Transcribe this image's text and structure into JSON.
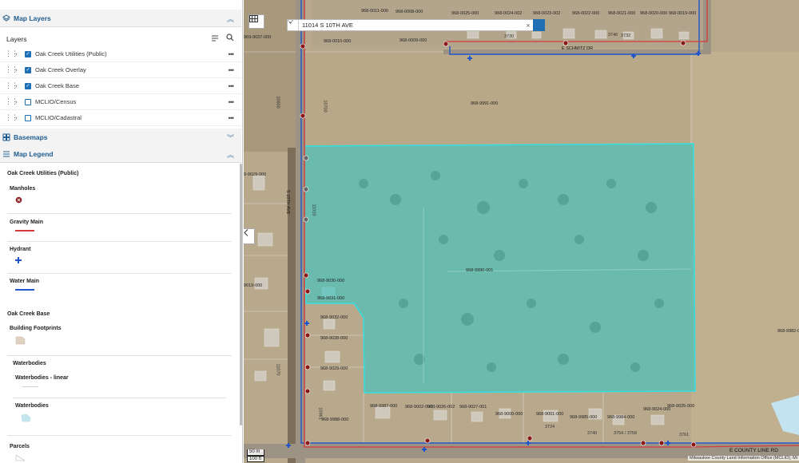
{
  "panel": {
    "map_layers_title": "Map Layers",
    "layers_label": "Layers",
    "layers": [
      {
        "label": "Oak Creek Utilities (Public)",
        "checked": true
      },
      {
        "label": "Oak Creek Overlay",
        "checked": true
      },
      {
        "label": "Oak Creek Base",
        "checked": true
      },
      {
        "label": "MCLIO/Census",
        "checked": false
      },
      {
        "label": "MCLIO/Cadastral",
        "checked": false
      }
    ],
    "basemaps_title": "Basemaps",
    "map_legend_title": "Map Legend"
  },
  "legend": {
    "utilities_title": "Oak Creek Utilities (Public)",
    "manholes": "Manholes",
    "gravity_main": "Gravity Main",
    "hydrant": "Hydrant",
    "water_main": "Water Main",
    "base_title": "Oak Creek Base",
    "building_footprints": "Building Footprints",
    "waterbodies_group": "Waterbodies",
    "waterbodies_linear": "Waterbodies - linear",
    "waterbodies": "Waterbodies",
    "parcels": "Parcels"
  },
  "map": {
    "search_value": "11014 S 10TH AVE",
    "scale_metric": "50 m",
    "scale_imperial": "100 ft",
    "attribution": "Milwaukee County Land Information Office (MCLIO), Mi",
    "roads": {
      "schmitz": "E SCHMITZ DR",
      "tenth": "S 10TH AVE",
      "county_line": "E COUNTY LINE RD"
    },
    "parcel_labels": [
      "968-0011-000",
      "968-0008-000",
      "968-0025-000",
      "968-0024-002",
      "968-0023-002",
      "968-0022-000",
      "968-0021-000",
      "968-0020-000",
      "968-0019-000",
      "968-0010-000",
      "968-0009-000",
      "969-9037-000",
      "968-9991-000",
      "968-9990-001",
      "968-9030-000",
      "968-9031-000",
      "968-9032-000",
      "968-9028-000",
      "968-9029-000",
      "968-9987-000",
      "968-9002-000",
      "968-9026-002",
      "968-9027-001",
      "968-9000-000",
      "968-9001-000",
      "968-9985-000",
      "968-9984-000",
      "968-9024-000",
      "968-9025-000",
      "968-9988-000",
      "968-9982-0",
      "9-9029-000",
      "9019-000"
    ],
    "address_labels": [
      "3730",
      "3746",
      "3732",
      "3740",
      "3754 / 3758",
      "3724",
      "3761",
      "10700",
      "10600",
      "11010",
      "11070",
      "10961"
    ]
  },
  "colors": {
    "accent": "#1f5c8f",
    "selection_fill": "#40c4c0",
    "selection_stroke": "#33e0e0",
    "gravity_main": "#d43a3a",
    "water_main": "#1f55c8"
  }
}
